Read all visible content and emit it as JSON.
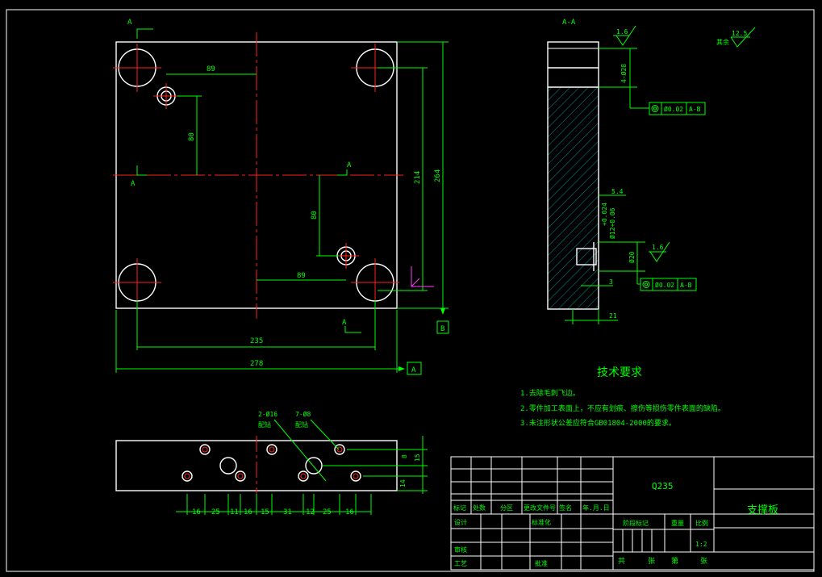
{
  "views": {
    "section_label": "A-A",
    "section_mark_a": "A",
    "datum_b": "B",
    "datum_a": "A"
  },
  "dims": {
    "d89_top": "89",
    "d80_left": "80",
    "d80_right": "80",
    "d89_bottom": "89",
    "d214": "214",
    "d264": "264",
    "d235": "235",
    "d278": "278",
    "d5_4": "5.4",
    "d_hole_tol": "+0.024\n-0.06",
    "d_hole_tol_text": "Ø12+0.06",
    "d_hole_tol_top": "+0.024",
    "d3": "3",
    "d21": "21",
    "d20": "Ø20",
    "d4_phi": "4-Ø28",
    "d15": "15",
    "d14": "14",
    "d8": "8",
    "bottom_dims": [
      "16",
      "25",
      "11",
      "16",
      "15",
      "31",
      "12",
      "25",
      "16"
    ]
  },
  "surface": {
    "rough1": "1.6",
    "rough2": "1.6",
    "rough_rest": "12.5",
    "rest_label": "其余"
  },
  "tolerance": {
    "frame1_value": "Ø0.02",
    "frame1_datum": "A-B",
    "frame2_value": "Ø0.02",
    "frame2_datum": "A-B"
  },
  "callouts": {
    "c1_spec": "2-Ø16",
    "c1_name": "配钻",
    "c2_spec": "7-Ø8",
    "c2_name": "配钻"
  },
  "requirements": {
    "title": "技术要求",
    "items": [
      "1.去除毛刺飞边。",
      "2.零件加工表面上，不应有划痕、擦伤等损伤零件表面的缺陷。",
      "3.未注形状公差应符合GB01804-2000的要求。"
    ]
  },
  "titleblock": {
    "material": "Q235",
    "part_name": "支撑板",
    "h_mark": "标记",
    "h_count": "处数",
    "h_zone": "分区",
    "h_doc": "更改文件号",
    "h_sign": "签名",
    "h_date": "年.月.日",
    "design": "设计",
    "standard": "标准化",
    "review": "审核",
    "process": "工艺",
    "approve": "批准",
    "stage": "阶段标记",
    "weight": "重量",
    "scale": "比例",
    "scale_value": "1:2",
    "total": "共",
    "sheets": "张",
    "page": "第",
    "sheet2": "张"
  }
}
